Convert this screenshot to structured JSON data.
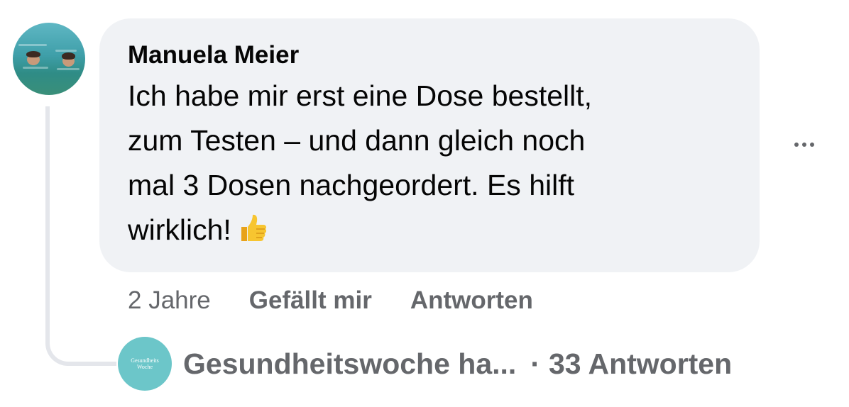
{
  "comment": {
    "author": "Manuela Meier",
    "lines": [
      "Ich habe mir erst eine Dose bestellt,",
      "zum Testen – und dann gleich noch",
      "mal 3 Dosen nachgeordert. Es hilft",
      "wirklich!"
    ],
    "emoji": "thumbs-up-emoji",
    "avatar": "profile-photo-swimmers"
  },
  "actions": {
    "time": "2 Jahre",
    "like": "Gefällt mir",
    "reply": "Antworten"
  },
  "more_icon": "more-options-icon",
  "replies": {
    "avatar_text": [
      "Gesundheits",
      "Woche"
    ],
    "label": "Gesundheitswoche ha...",
    "separator": "·",
    "count_label": "33 Antworten"
  },
  "colors": {
    "bubble": "#f0f2f5",
    "text": "#050505",
    "secondary": "#65676b",
    "thread_line": "#e4e6eb",
    "reply_avatar": "#6cc6c9"
  }
}
